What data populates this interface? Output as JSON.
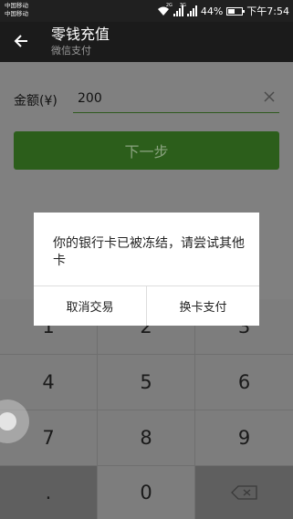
{
  "status_bar": {
    "carrier_1": "中国移动",
    "carrier_2": "中国移动",
    "sig1_tag": "2G",
    "sig2_tag": "3G",
    "battery_percent": "44%",
    "time": "下午7:54"
  },
  "app_bar": {
    "title": "零钱充值",
    "subtitle": "微信支付"
  },
  "form": {
    "amount_label": "金额(¥)",
    "amount_value": "200",
    "next_button": "下一步"
  },
  "dialog": {
    "message": "你的银行卡已被冻结，请尝试其他卡",
    "cancel_button": "取消交易",
    "change_card_button": "换卡支付"
  },
  "keypad": {
    "keys": [
      "1",
      "2",
      "3",
      "4",
      "5",
      "6",
      "7",
      "8",
      "9",
      ".",
      "0"
    ],
    "backspace_icon": "backspace-icon"
  },
  "colors": {
    "accent_green": "#2c5e1b",
    "overlay": "#808080"
  }
}
